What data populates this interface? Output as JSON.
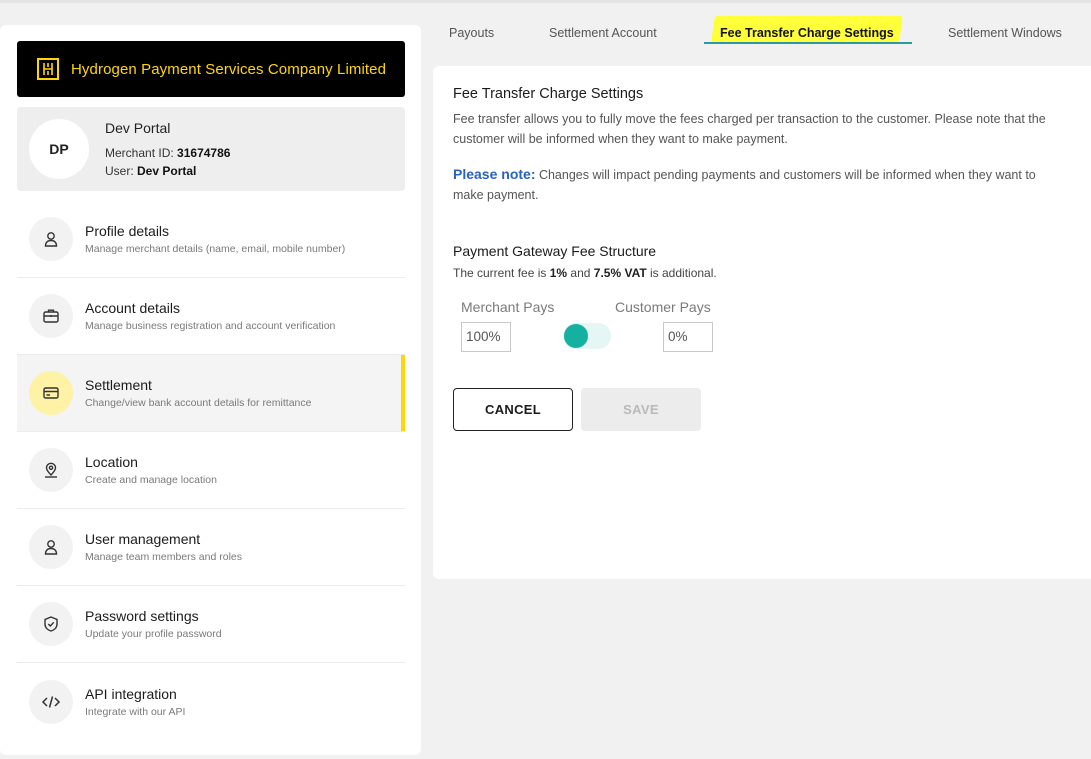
{
  "company": {
    "name": "Hydrogen Payment Services Company Limited",
    "logo_icon": "hydrogen-logo-icon"
  },
  "profile": {
    "initials": "DP",
    "name": "Dev Portal",
    "merchant_id_label": "Merchant ID:",
    "merchant_id": "31674786",
    "user_label": "User:",
    "user": "Dev Portal"
  },
  "menu": [
    {
      "title": "Profile details",
      "subtitle": "Manage merchant details (name, email, mobile number)",
      "icon": "user-icon"
    },
    {
      "title": "Account details",
      "subtitle": "Manage business registration and account verification",
      "icon": "briefcase-icon"
    },
    {
      "title": "Settlement",
      "subtitle": "Change/view bank account details for remittance",
      "icon": "card-icon",
      "active": true
    },
    {
      "title": "Location",
      "subtitle": "Create and manage location",
      "icon": "location-pin-icon"
    },
    {
      "title": "User management",
      "subtitle": "Manage team members and roles",
      "icon": "user-icon"
    },
    {
      "title": "Password settings",
      "subtitle": "Update your profile password",
      "icon": "shield-check-icon"
    },
    {
      "title": "API integration",
      "subtitle": "Integrate with our API",
      "icon": "code-icon"
    }
  ],
  "tabs": [
    {
      "label": "Payouts"
    },
    {
      "label": "Settlement Account"
    },
    {
      "label": "Fee Transfer Charge Settings",
      "active": true
    },
    {
      "label": "Settlement Windows"
    }
  ],
  "fee_settings": {
    "title": "Fee Transfer Charge Settings",
    "description": "Fee transfer allows you to fully move the fees charged per transaction to the customer. Please note that the customer will be informed when they want to make payment.",
    "note_label": "Please note:",
    "note_text": " Changes will impact pending payments and customers will be informed when they want to make payment.",
    "structure_title": "Payment Gateway Fee Structure",
    "fee_prefix": "The current fee is ",
    "fee_percent": "1%",
    "fee_and": " and ",
    "fee_vat": "7.5% VAT",
    "fee_suffix": " is additional.",
    "merchant_label": "Merchant Pays",
    "customer_label": "Customer Pays",
    "merchant_value": "100%",
    "customer_value": "0%",
    "toggle_on": false,
    "cancel_label": "CANCEL",
    "save_label": "SAVE"
  },
  "colors": {
    "brand_yellow": "#ffd60a",
    "teal": "#14b1a0",
    "note_blue": "#2a63b8",
    "highlight": "#ffff3a"
  }
}
